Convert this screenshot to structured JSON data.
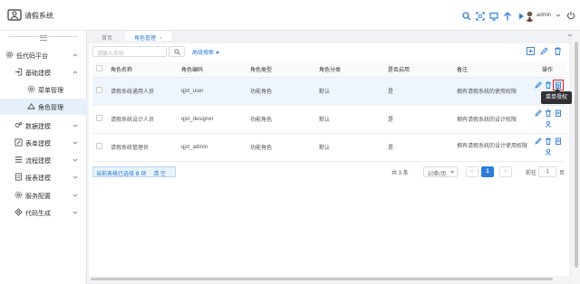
{
  "header": {
    "app_title": "请假系统",
    "user_name": "admin",
    "icons": [
      "search-icon",
      "expand-icon",
      "monitor-icon",
      "arrow-up-icon",
      "play-icon"
    ],
    "accent": "#2b7dd8"
  },
  "sidebar": {
    "items": [
      {
        "label": "低代码平台",
        "icon": "gear-icon"
      },
      {
        "label": "基础建模",
        "icon": "login-icon"
      },
      {
        "label": "菜单管理",
        "icon": "cog-icon"
      },
      {
        "label": "角色管理",
        "icon": "role-icon"
      },
      {
        "label": "数据建模",
        "icon": "data-icon"
      },
      {
        "label": "表单建模",
        "icon": "form-icon"
      },
      {
        "label": "流程建模",
        "icon": "list-icon"
      },
      {
        "label": "报表建模",
        "icon": "report-icon"
      },
      {
        "label": "服务配置",
        "icon": "service-icon"
      },
      {
        "label": "代码生成",
        "icon": "code-icon"
      }
    ]
  },
  "tabs": [
    {
      "label": "首页"
    },
    {
      "label": "角色管理",
      "close": "×"
    }
  ],
  "search": {
    "placeholder": "请输入名称",
    "advanced_label": "高级搜索"
  },
  "table": {
    "headers": [
      "角色名称",
      "角色编码",
      "角色类型",
      "角色分类",
      "是否启用",
      "备注",
      "操作"
    ],
    "rows": [
      {
        "name": "请假系统通用人员",
        "code": "qjxt_user",
        "type": "功能角色",
        "category": "默认",
        "enabled": "是",
        "remark": "拥有请假系统的使用权限"
      },
      {
        "name": "请假系统设计人员",
        "code": "qjxt_designer",
        "type": "功能角色",
        "category": "默认",
        "enabled": "是",
        "remark": "拥有请假系统的设计权限"
      },
      {
        "name": "请假系统管理员",
        "code": "qjxt_admin",
        "type": "功能角色",
        "category": "默认",
        "enabled": "是",
        "remark": "拥有请假系统的设计使用权限"
      }
    ]
  },
  "tooltip": "菜单授权",
  "selection": {
    "prefix": "当前表格已选择",
    "count": "0",
    "unit": "项",
    "clear": "清 空"
  },
  "pagination": {
    "total": "共 3 条",
    "page_size": "10条/页",
    "prev": "<",
    "current": "1",
    "next": ">",
    "jump_label": "前往",
    "jump_value": "1",
    "jump_suffix": "页"
  }
}
